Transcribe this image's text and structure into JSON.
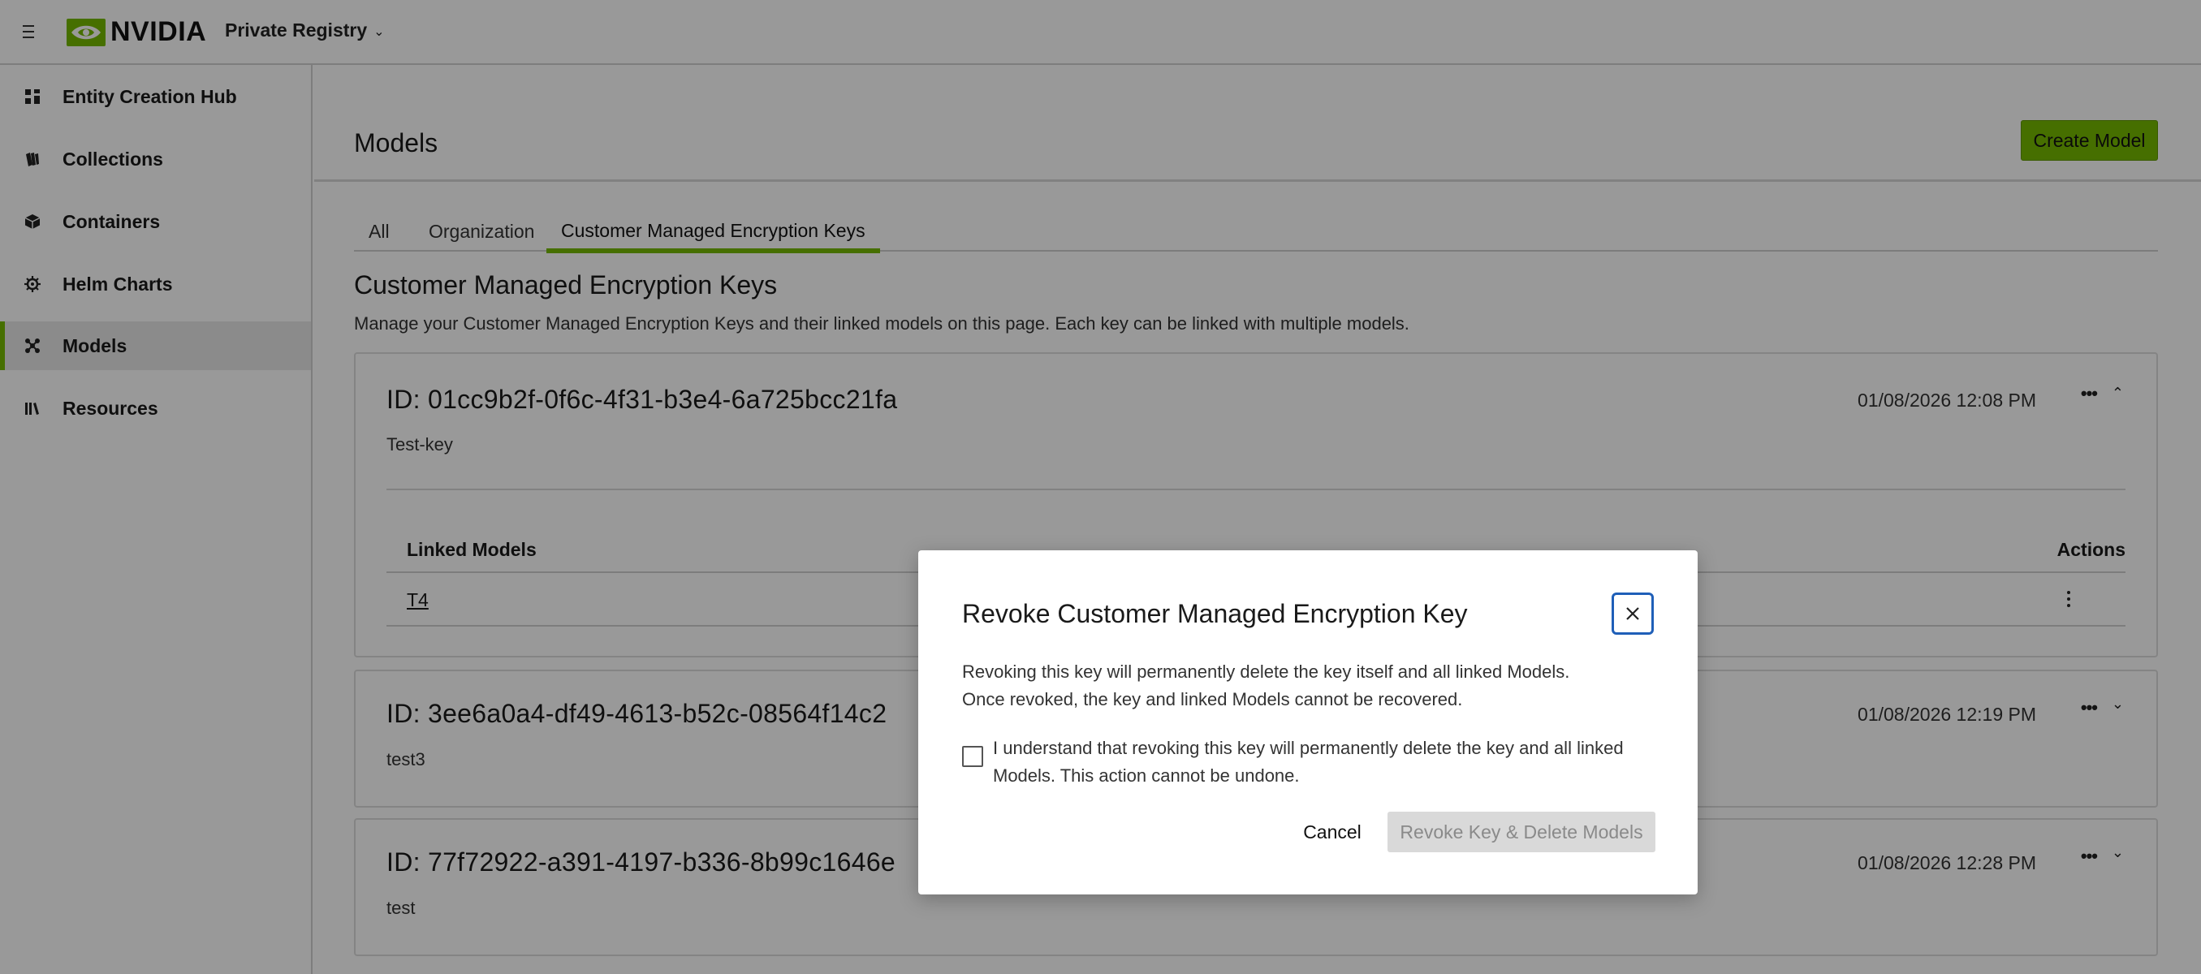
{
  "header": {
    "brand": "NVIDIA",
    "registry_label": "Private Registry"
  },
  "sidebar": {
    "items": [
      {
        "label": "Entity Creation Hub",
        "icon": "grid-icon"
      },
      {
        "label": "Collections",
        "icon": "collections-icon"
      },
      {
        "label": "Containers",
        "icon": "cube-icon"
      },
      {
        "label": "Helm Charts",
        "icon": "helm-icon"
      },
      {
        "label": "Models",
        "icon": "models-icon",
        "active": true
      },
      {
        "label": "Resources",
        "icon": "books-icon"
      }
    ]
  },
  "main": {
    "title": "Models",
    "create_button": "Create Model",
    "tabs": [
      {
        "label": "All"
      },
      {
        "label": "Organization"
      },
      {
        "label": "Customer Managed Encryption Keys",
        "active": true
      }
    ],
    "section_title": "Customer Managed Encryption Keys",
    "section_description": "Manage your Customer Managed Encryption Keys and their linked models on this page. Each key can be linked with multiple models.",
    "keys": [
      {
        "id": "ID: 01cc9b2f-0f6c-4f31-b3e4-6a725bcc21fa",
        "name": "Test-key",
        "date": "01/08/2026 12:08 PM",
        "expanded": true,
        "linked_models_header": "Linked Models",
        "actions_header": "Actions",
        "linked_models": [
          "T4"
        ]
      },
      {
        "id": "ID: 3ee6a0a4-df49-4613-b52c-08564f14c2",
        "name": "test3",
        "date": "01/08/2026 12:19 PM",
        "expanded": false
      },
      {
        "id": "ID: 77f72922-a391-4197-b336-8b99c1646e",
        "name": "test",
        "date": "01/08/2026 12:28 PM",
        "expanded": false
      }
    ]
  },
  "modal": {
    "title": "Revoke Customer Managed Encryption Key",
    "body_line1": "Revoking this key will permanently delete the key itself and all linked Models.",
    "body_line2": "Once revoked, the key and linked Models cannot be recovered.",
    "checkbox_label": "I understand that revoking this key will permanently delete the key and all linked Models. This action cannot be undone.",
    "checkbox_checked": false,
    "cancel_label": "Cancel",
    "confirm_label": "Revoke Key & Delete Models",
    "confirm_disabled": true
  },
  "colors": {
    "accent": "#76b900",
    "focus_ring": "#1f5fb8",
    "disabled_button": "#d9d9d9"
  }
}
